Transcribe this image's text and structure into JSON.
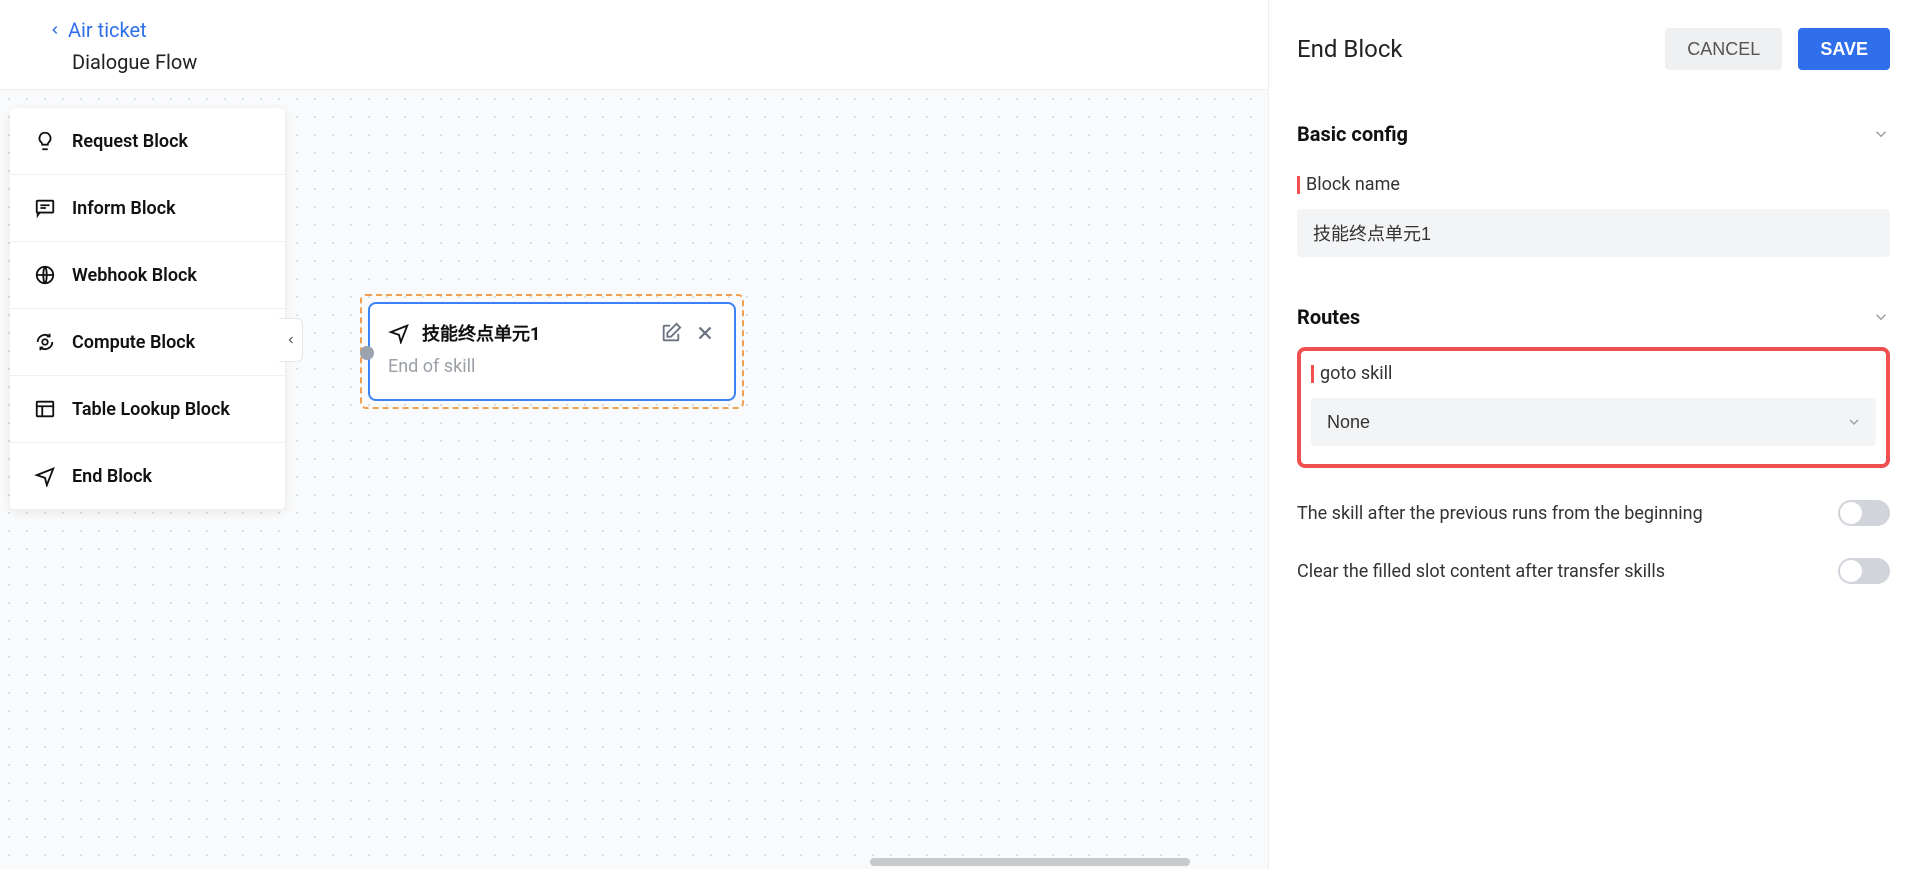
{
  "header": {
    "breadcrumb": "Air ticket",
    "title": "Dialogue Flow"
  },
  "palette": {
    "items": [
      {
        "label": "Request Block",
        "icon": "bulb-icon"
      },
      {
        "label": "Inform Block",
        "icon": "chat-icon"
      },
      {
        "label": "Webhook Block",
        "icon": "globe-icon"
      },
      {
        "label": "Compute Block",
        "icon": "gear-arrows-icon"
      },
      {
        "label": "Table Lookup Block",
        "icon": "table-icon"
      },
      {
        "label": "End Block",
        "icon": "nav-arrow-icon"
      }
    ]
  },
  "node": {
    "title": "技能终点单元1",
    "subtitle": "End of skill",
    "icon": "nav-arrow-icon"
  },
  "panel": {
    "title": "End Block",
    "cancel_label": "CANCEL",
    "save_label": "SAVE",
    "sections": {
      "basic": "Basic config",
      "routes": "Routes"
    },
    "block_name_label": "Block name",
    "block_name_value": "技能终点单元1",
    "goto_label": "goto skill",
    "goto_value": "None",
    "toggle1": "The skill after the previous runs from the beginning",
    "toggle2": "Clear the filled slot content after transfer skills"
  }
}
